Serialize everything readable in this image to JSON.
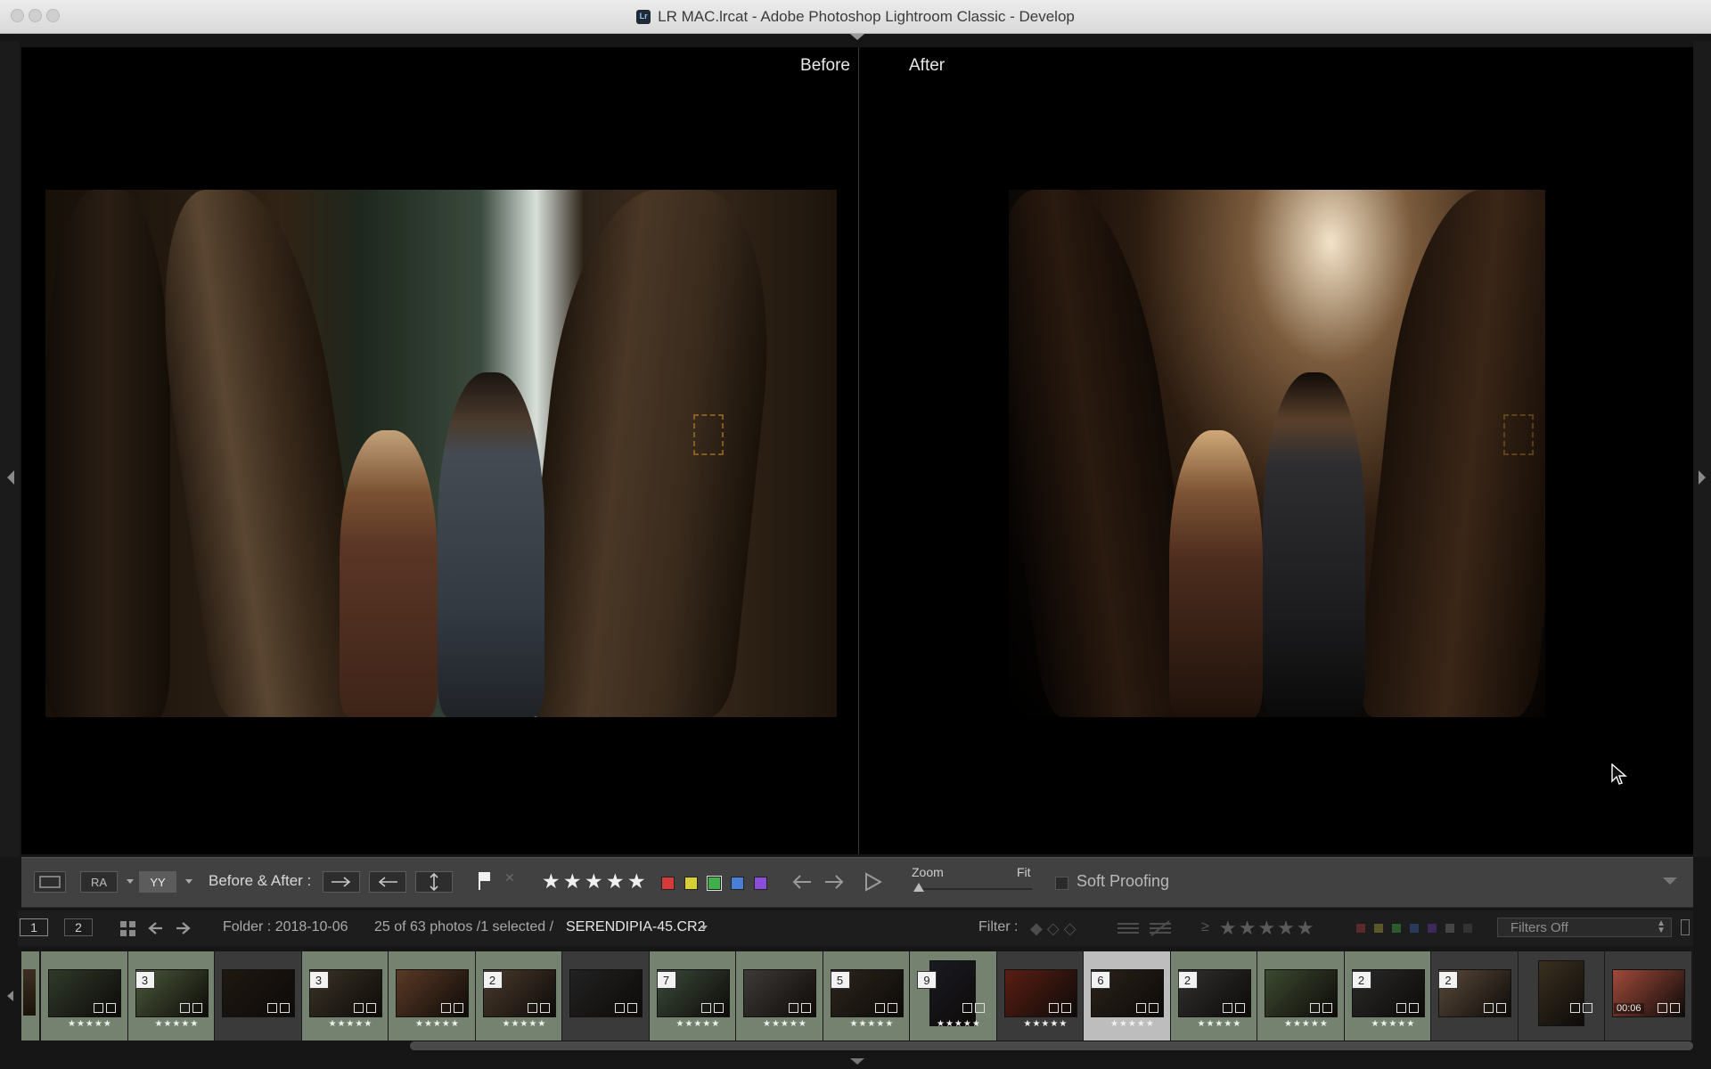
{
  "window": {
    "title": "LR MAC.lrcat - Adobe Photoshop Lightroom Classic - Develop",
    "app_icon_text": "Lr"
  },
  "viewer": {
    "before_label": "Before",
    "after_label": "After"
  },
  "toolbar": {
    "view_ra_label": "RA",
    "view_yy_label": "YY",
    "before_after_label": "Before & After :",
    "stars": [
      "★",
      "★",
      "★",
      "★",
      "★"
    ],
    "zoom_label": "Zoom",
    "fit_label": "Fit",
    "soft_proofing_label": "Soft Proofing",
    "color_labels": {
      "red": "#d63b3b",
      "yellow": "#d6cf35",
      "green": "#42b04a",
      "blue": "#4a7fd8",
      "purple": "#8a4fd8"
    }
  },
  "filmbar": {
    "screen1": "1",
    "screen2": "2",
    "folder_label": "Folder : 2018-10-06",
    "count_label": "25 of 63 photos /1 selected /",
    "filename": "SERENDIPIA-45.CR2",
    "filter_label": "Filter :",
    "gte_symbol": "≥",
    "filter_stars": "★★★★★",
    "filters_off": "Filters Off"
  },
  "filmstrip": {
    "thumbs": [
      {
        "badge": "",
        "stars": "★★★★★"
      },
      {
        "badge": "3",
        "stars": "★★★★★"
      },
      {
        "badge": "",
        "stars": ""
      },
      {
        "badge": "3",
        "stars": "★★★★★"
      },
      {
        "badge": "",
        "stars": "★★★★★"
      },
      {
        "badge": "2",
        "stars": "★★★★★"
      },
      {
        "badge": "",
        "stars": ""
      },
      {
        "badge": "7",
        "stars": "★★★★★"
      },
      {
        "badge": "",
        "stars": "★★★★★"
      },
      {
        "badge": "5",
        "stars": "★★★★★"
      },
      {
        "badge": "9",
        "stars": "★★★★★"
      },
      {
        "badge": "",
        "stars": "★★★★★"
      },
      {
        "badge": "6",
        "stars": "★★★★★"
      },
      {
        "badge": "2",
        "stars": "★★★★★"
      },
      {
        "badge": "",
        "stars": "★★★★★"
      },
      {
        "badge": "2",
        "stars": "★★★★★"
      },
      {
        "badge": "2",
        "stars": ""
      },
      {
        "badge": "",
        "stars": ""
      },
      {
        "badge": "",
        "stars": ""
      }
    ],
    "video_duration": "00:06"
  }
}
